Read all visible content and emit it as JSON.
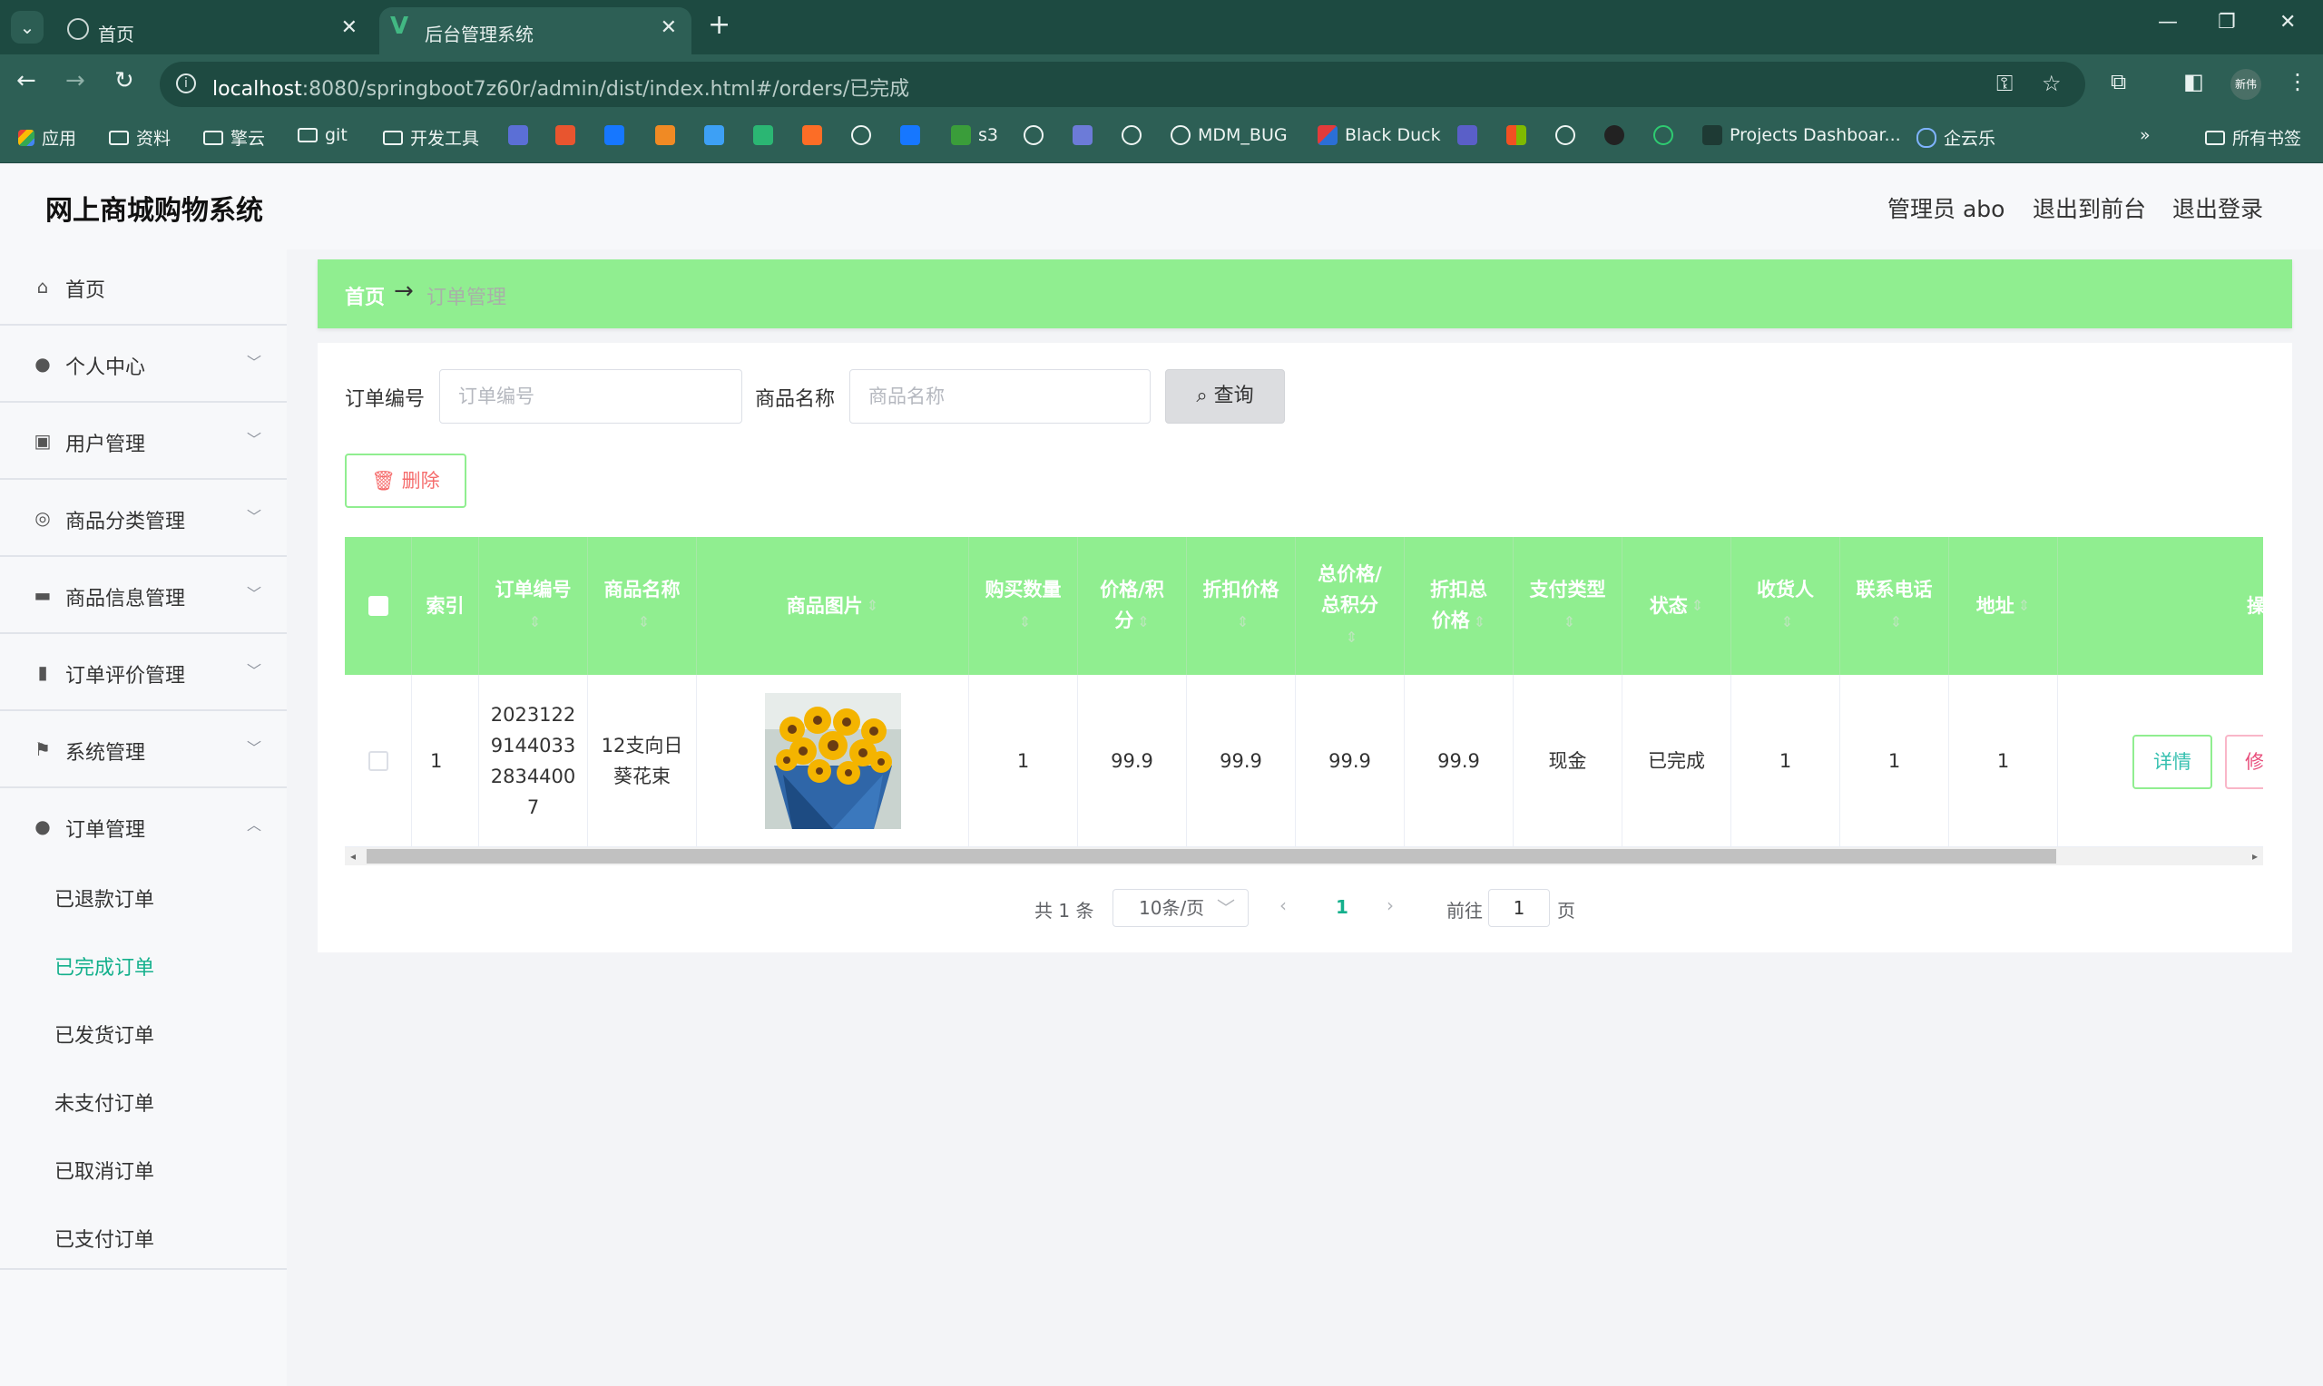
{
  "browser": {
    "tabs": [
      {
        "title": "首页",
        "active": false
      },
      {
        "title": "后台管理系统",
        "active": true
      }
    ],
    "url_host": "localhost",
    "url_rest": ":8080/springboot7z60r/admin/dist/index.html#/orders/已完成",
    "profile_label": "新伟",
    "bookmarks": [
      "应用",
      "资料",
      "擎云",
      "git",
      "开发工具",
      "s3",
      "MDM_BUG",
      "Black Duck",
      "Projects Dashboar...",
      "企云乐"
    ],
    "all_bookmarks": "所有书签"
  },
  "app": {
    "title": "网上商城购物系统",
    "header_links": [
      "管理员 abo",
      "退出到前台",
      "退出登录"
    ]
  },
  "sidebar": {
    "items": [
      {
        "label": "首页",
        "icon": "home-icon"
      },
      {
        "label": "个人中心",
        "icon": "user-icon"
      },
      {
        "label": "用户管理",
        "icon": "users-icon"
      },
      {
        "label": "商品分类管理",
        "icon": "category-icon"
      },
      {
        "label": "商品信息管理",
        "icon": "monitor-icon"
      },
      {
        "label": "订单评价管理",
        "icon": "chart-icon"
      },
      {
        "label": "系统管理",
        "icon": "flag-icon"
      },
      {
        "label": "订单管理",
        "icon": "user-icon"
      }
    ],
    "sub_items": [
      "已退款订单",
      "已完成订单",
      "已发货订单",
      "未支付订单",
      "已取消订单",
      "已支付订单"
    ],
    "active_sub": "已完成订单"
  },
  "breadcrumb": {
    "home": "首页",
    "separator": "→",
    "current": "订单管理"
  },
  "search": {
    "order_no_label": "订单编号",
    "order_no_placeholder": "订单编号",
    "product_label": "商品名称",
    "product_placeholder": "商品名称",
    "query_button": "查询"
  },
  "actions": {
    "delete_button": "删除"
  },
  "table": {
    "headers": [
      "索引",
      "订单编号",
      "商品名称",
      "商品图片",
      "购买数量",
      "价格/积分",
      "折扣价格",
      "总价格/总积分",
      "折扣总价格",
      "支付类型",
      "状态",
      "收货人",
      "联系电话",
      "地址",
      "操作"
    ],
    "rows": [
      {
        "index": "1",
        "order_no": "20231229144033283440​07",
        "order_no_lines": [
          "2023122",
          "9144033",
          "2834400",
          "7"
        ],
        "product": "12支向日葵花束",
        "product_lines": [
          "12支向日",
          "葵花束"
        ],
        "qty": "1",
        "price": "99.9",
        "discount_price": "99.9",
        "total": "99.9",
        "discount_total": "99.9",
        "pay_type": "现金",
        "status": "已完成",
        "receiver": "1",
        "phone": "1",
        "address": "1",
        "detail_button": "详情",
        "edit_button": "修"
      }
    ]
  },
  "pagination": {
    "total_text": "共 1 条",
    "page_size": "10条/页",
    "current_page": "1",
    "goto_label": "前往",
    "goto_value": "1",
    "page_unit": "页"
  },
  "colors": {
    "accent_green": "#90ee90",
    "active_link": "#14b08c",
    "danger": "#f56c6c",
    "browser_frame": "#1d4a41"
  }
}
